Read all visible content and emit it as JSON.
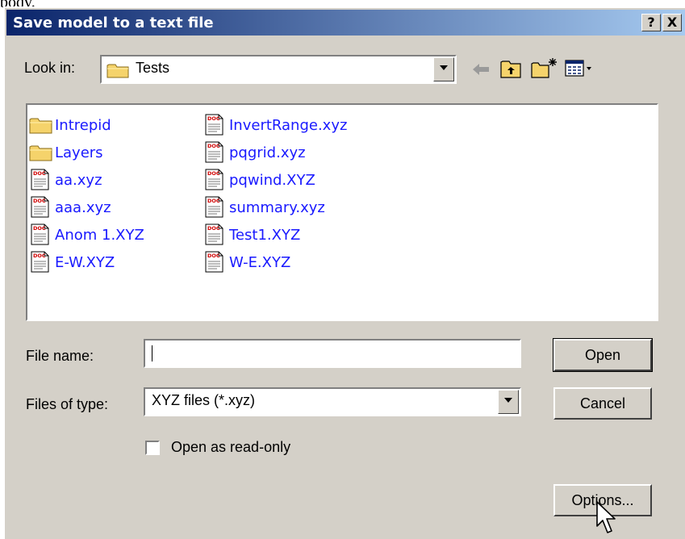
{
  "page_fragment": "body.",
  "window": {
    "title": "Save model to a text file",
    "help_button": "?",
    "close_button": "X"
  },
  "look_in": {
    "label": "Look in:",
    "value": "Tests"
  },
  "toolbar": {
    "icons": [
      "back-arrow-icon",
      "up-one-level-icon",
      "create-new-folder-icon",
      "view-menu-icon"
    ]
  },
  "files": {
    "column1": [
      {
        "name": "Intrepid",
        "type": "folder"
      },
      {
        "name": "Layers",
        "type": "folder"
      },
      {
        "name": "aa.xyz",
        "type": "document"
      },
      {
        "name": "aaa.xyz",
        "type": "document"
      },
      {
        "name": "Anom 1.XYZ",
        "type": "document"
      },
      {
        "name": "E-W.XYZ",
        "type": "document"
      }
    ],
    "column2": [
      {
        "name": "InvertRange.xyz",
        "type": "document"
      },
      {
        "name": "pqgrid.xyz",
        "type": "document"
      },
      {
        "name": "pqwind.XYZ",
        "type": "document"
      },
      {
        "name": "summary.xyz",
        "type": "document"
      },
      {
        "name": "Test1.XYZ",
        "type": "document"
      },
      {
        "name": "W-E.XYZ",
        "type": "document"
      }
    ]
  },
  "file_name": {
    "label": "File name:",
    "value": ""
  },
  "files_of_type": {
    "label": "Files of type:",
    "value": "XYZ files (*.xyz)"
  },
  "read_only": {
    "label": "Open as read-only",
    "checked": false
  },
  "buttons": {
    "open": "Open",
    "cancel": "Cancel",
    "options": "Options..."
  },
  "colors": {
    "title_start": "#0a246a",
    "title_end": "#a6caf0",
    "face": "#d4d0c8",
    "file_link": "#1a1aff",
    "folder": "#f5d36b"
  }
}
